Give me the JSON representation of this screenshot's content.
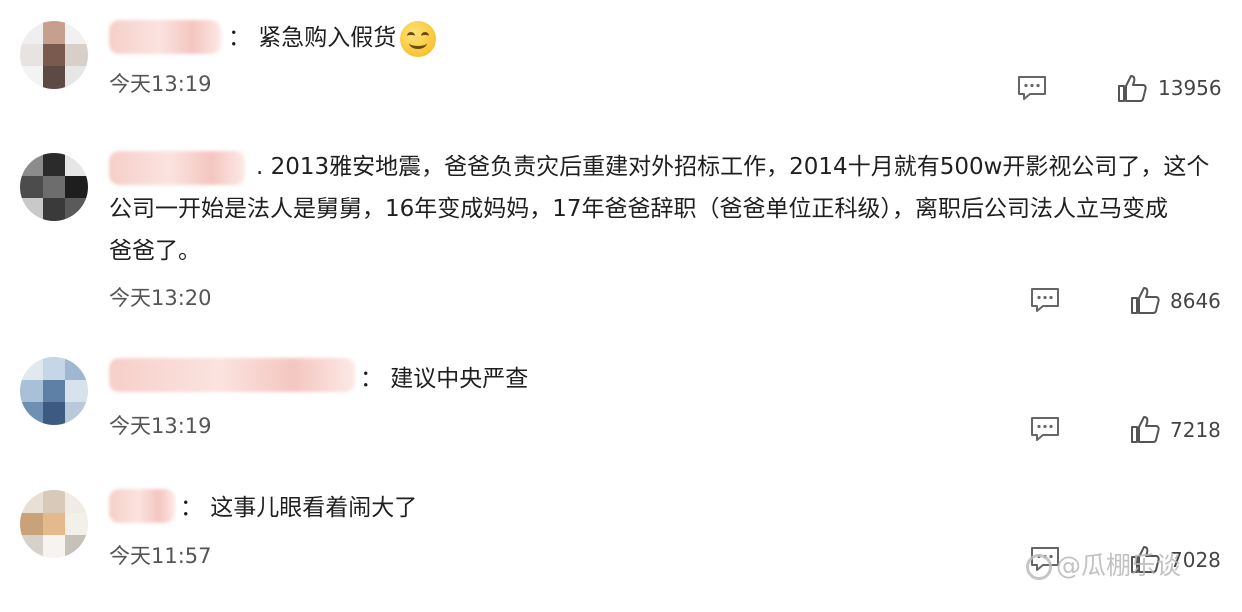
{
  "comments": [
    {
      "text": "： 紧急购入假货",
      "emoji": "smile-emoji",
      "time": "今天13:19",
      "likes": "13956",
      "avatar_colors": [
        "#efefef",
        "#c79f8f",
        "#f1f1f1",
        "#e8e3e0",
        "#7a5a4e",
        "#d9cfc9",
        "#f3f3f3",
        "#5d4a44",
        "#e6e6e6"
      ]
    },
    {
      "text": ". 2013雅安地震，爸爸负责灾后重建对外招标工作，2014十月就有500w开影视公司了，这个\n公司一开始是法人是舅舅，16年变成妈妈，17年爸爸辞职（爸爸单位正科级），离职后公司法人立马变成\n爸爸了。",
      "time": "今天13:20",
      "likes": "8646",
      "avatar_colors": [
        "#8c8c8c",
        "#2b2b2b",
        "#e6e6e6",
        "#4c4c4c",
        "#6d6d6d",
        "#1e1e1e",
        "#c9c9c9",
        "#3a3a3a",
        "#5a5a5a"
      ]
    },
    {
      "text": "： 建议中央严查",
      "time": "今天13:19",
      "likes": "7218",
      "avatar_colors": [
        "#e1e8ee",
        "#c5d6e6",
        "#9fb7d1",
        "#a8c0d8",
        "#5e7fa6",
        "#d6e2ec",
        "#6f8fb3",
        "#3d5a80",
        "#b8c9da"
      ]
    },
    {
      "text": "： 这事儿眼看着闹大了",
      "time": "今天11:57",
      "likes": "7028",
      "avatar_colors": [
        "#e8e0d5",
        "#d8c9b8",
        "#f0ebe4",
        "#caa27a",
        "#e4b98c",
        "#f3efe9",
        "#d6d1ca",
        "#f7f3ee",
        "#c7c1b9"
      ]
    }
  ],
  "watermark": "@瓜棚乐谈"
}
